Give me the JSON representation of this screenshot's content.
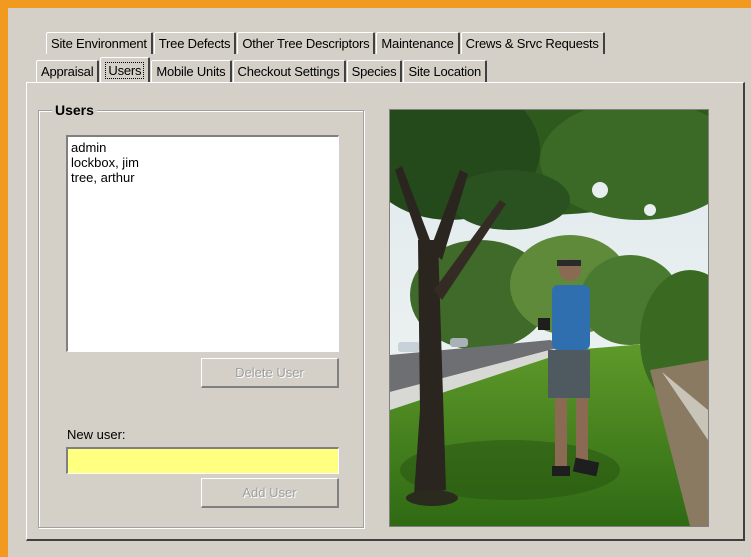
{
  "tabs_back": [
    "Site Environment",
    "Tree Defects",
    "Other Tree Descriptors",
    "Maintenance",
    "Crews & Srvc Requests"
  ],
  "tabs_front": [
    "Appraisal",
    "Users",
    "Mobile Units",
    "Checkout Settings",
    "Species",
    "Site Location"
  ],
  "active_tab": "Users",
  "users_group": {
    "title": "Users",
    "list": [
      "admin",
      "lockbox, jim",
      "tree, arthur"
    ],
    "delete_button": "Delete User",
    "new_user_label": "New user:",
    "new_user_value": "",
    "add_button": "Add User"
  },
  "colors": {
    "window_border": "#f29a1f",
    "input_highlight": "#ffff80",
    "disabled_text": "#a0a0a0"
  }
}
